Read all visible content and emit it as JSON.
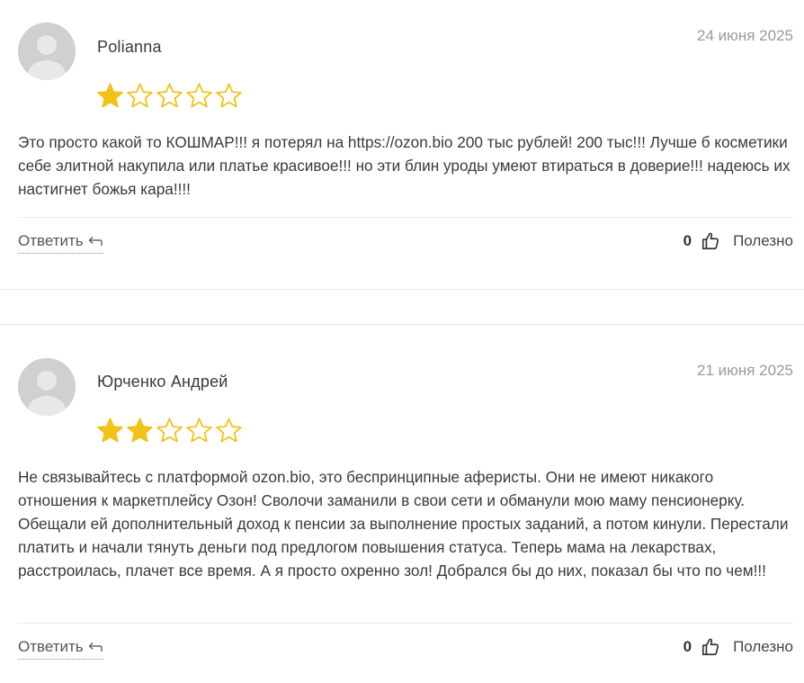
{
  "reviews": [
    {
      "author": "Polianna",
      "date": "24 июня 2025",
      "rating": 1,
      "max_rating": 5,
      "text": "Это просто какой то КОШМАР!!! я потерял на https://ozon.bio 200 тыс рублей! 200 тыс!!! Лучше б косметики себе элитной накупила или платье красивое!!! но эти блин уроды умеют втираться в доверие!!! надеюсь их настигнет божья кара!!!!",
      "reply_label": "Ответить",
      "likes": "0",
      "helpful_label": "Полезно"
    },
    {
      "author": "Юрченко Андрей",
      "date": "21 июня 2025",
      "rating": 2,
      "max_rating": 5,
      "text": "Не связывайтесь с платформой ozon.bio, это беспринципные аферисты. Они не имеют никакого отношения к маркетплейсу Озон! Сволочи заманили в свои сети и обманули мою маму пенсионерку. Обещали ей дополнительный доход к пенсии за выполнение простых заданий, а потом кинули. Перестали платить и начали тянуть деньги под предлогом повышения статуса. Теперь мама на лекарствах, расстроилась, плачет все время. А я просто охренно зол! Добрался бы до них, показал бы что по чем!!!",
      "reply_label": "Ответить",
      "likes": "0",
      "helpful_label": "Полезно"
    }
  ],
  "colors": {
    "star_fill": "#f2c21b",
    "star_outline": "#f2c21b",
    "avatar_bg": "#d0d0d0",
    "avatar_fg": "#e8e8e8"
  },
  "icons": {
    "avatar": "user-silhouette-icon",
    "star": "star-icon",
    "reply": "reply-arrow-icon",
    "like": "thumbs-up-icon"
  }
}
